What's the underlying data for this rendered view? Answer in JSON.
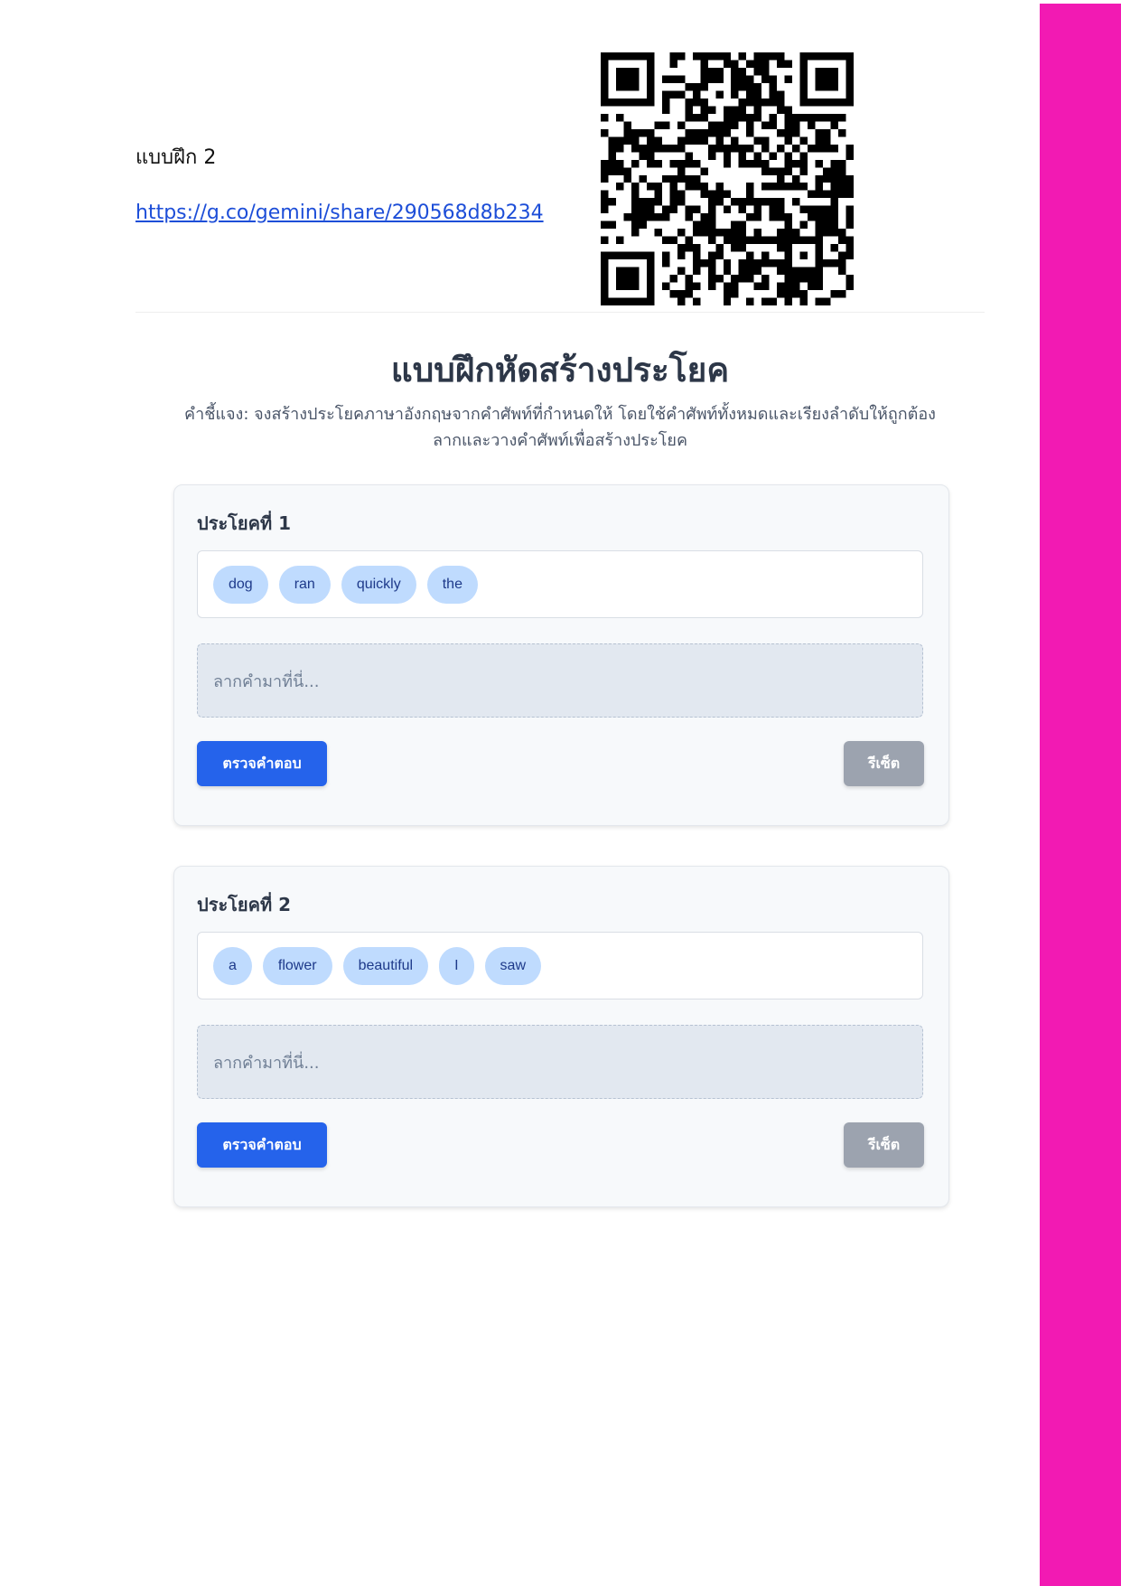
{
  "header": {
    "label": "แบบฝึก 2",
    "link": "https://g.co/gemini/share/290568d8b234"
  },
  "page": {
    "title": "แบบฝึกหัดสร้างประโยค",
    "instructions_line1": "คำชี้แจง: จงสร้างประโยคภาษาอังกฤษจากคำศัพท์ที่กำหนดให้ โดยใช้คำศัพท์ทั้งหมดและเรียงลำดับให้ถูกต้อง",
    "instructions_line2": "ลากและวางคำศัพท์เพื่อสร้างประโยค"
  },
  "exercises": [
    {
      "title": "ประโยคที่ 1",
      "words": [
        "dog",
        "ran",
        "quickly",
        "the"
      ],
      "drop_placeholder": "ลากคำมาที่นี่...",
      "check_label": "ตรวจคำตอบ",
      "reset_label": "รีเซ็ต"
    },
    {
      "title": "ประโยคที่ 2",
      "words": [
        "a",
        "flower",
        "beautiful",
        "I",
        "saw"
      ],
      "drop_placeholder": "ลากคำมาที่นี่...",
      "check_label": "ตรวจคำตอบ",
      "reset_label": "รีเซ็ต"
    }
  ],
  "colors": {
    "side_bar": "#f21ab3",
    "primary_button": "#2563eb",
    "reset_button": "#9ca3af",
    "chip_bg": "#bfdbfe"
  }
}
